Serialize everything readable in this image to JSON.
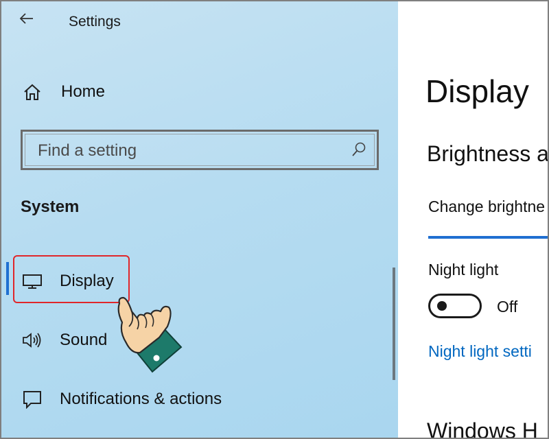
{
  "header": {
    "title": "Settings",
    "back_icon": "back-arrow-icon"
  },
  "sidebar": {
    "home_label": "Home",
    "search": {
      "placeholder": "Find a setting"
    },
    "section_title": "System",
    "items": [
      {
        "label": "Display",
        "icon": "monitor-icon",
        "selected": true
      },
      {
        "label": "Sound",
        "icon": "speaker-icon",
        "selected": false
      },
      {
        "label": "Notifications & actions",
        "icon": "notification-icon",
        "selected": false
      }
    ]
  },
  "content": {
    "page_title": "Display",
    "brightness_heading": "Brightness a",
    "brightness_label": "Change brightne",
    "night_light_label": "Night light",
    "night_light_state": "Off",
    "night_light_link": "Night light setti",
    "windows_heading": "Windows H"
  },
  "colors": {
    "accent": "#1f6fd1",
    "link": "#0067c0",
    "highlight": "#e0262a",
    "sidebar_bg": "#b6dcf1"
  }
}
